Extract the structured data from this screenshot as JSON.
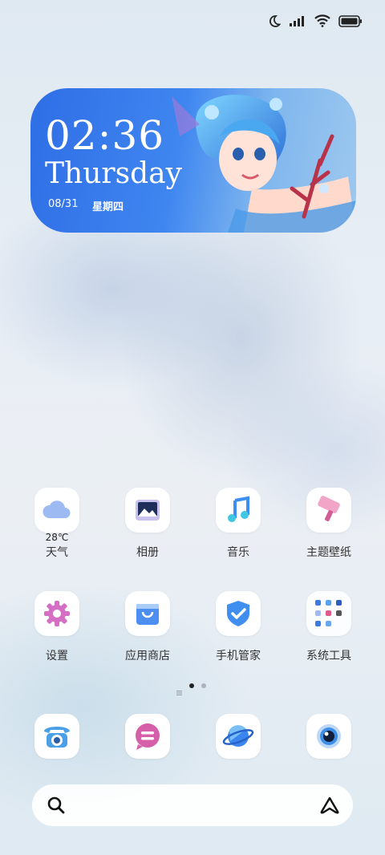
{
  "status_bar": {
    "icons": [
      "moon-icon",
      "signal-icon",
      "wifi-icon",
      "battery-icon"
    ]
  },
  "clock_widget": {
    "time": "02:36",
    "day_name": "Thursday",
    "date": "08/31",
    "weekday_cn": "星期四"
  },
  "apps_row1": [
    {
      "label": "天气",
      "icon": "cloud-icon",
      "extra": "28℃"
    },
    {
      "label": "相册",
      "icon": "gallery-icon"
    },
    {
      "label": "音乐",
      "icon": "music-note-icon"
    },
    {
      "label": "主题壁纸",
      "icon": "paint-roller-icon"
    }
  ],
  "apps_row2": [
    {
      "label": "设置",
      "icon": "gear-icon"
    },
    {
      "label": "应用商店",
      "icon": "shopping-bag-icon"
    },
    {
      "label": "手机管家",
      "icon": "shield-check-icon"
    },
    {
      "label": "系统工具",
      "icon": "folder-grid-icon"
    }
  ],
  "page_indicator": {
    "pages": 2,
    "active": 1
  },
  "dock": [
    {
      "icon": "phone-icon"
    },
    {
      "icon": "message-icon"
    },
    {
      "icon": "browser-planet-icon"
    },
    {
      "icon": "camera-eye-icon"
    }
  ],
  "search_bar": {
    "left_icon": "search-icon",
    "right_icon": "assistant-icon"
  }
}
